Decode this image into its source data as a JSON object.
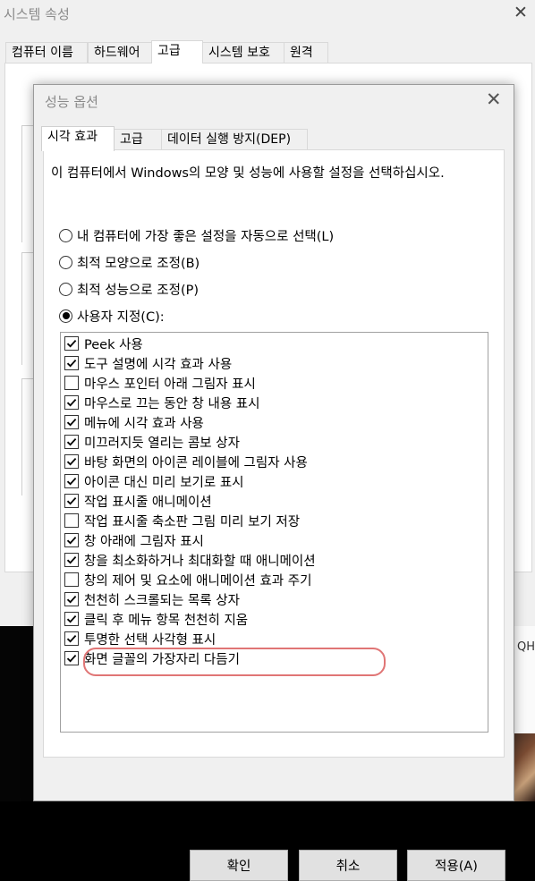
{
  "background_window": {
    "title": "시스템 속성",
    "close_glyph": "✕",
    "tabs": [
      "컴퓨터 이름",
      "하드웨어",
      "고급",
      "시스템 보호",
      "원격"
    ],
    "active_tab": "고급",
    "bottom_right_text": "QH"
  },
  "dialog": {
    "title": "성능 옵션",
    "close_glyph": "✕",
    "tabs": [
      "시각 효과",
      "고급",
      "데이터 실행 방지(DEP)"
    ],
    "active_tab": "시각 효과",
    "description": "이 컴퓨터에서 Windows의 모양 및 성능에 사용할 설정을 선택하십시오.",
    "radio_options": [
      {
        "label": "내 컴퓨터에 가장 좋은 설정을 자동으로 선택(L)",
        "selected": false
      },
      {
        "label": "최적 모양으로 조정(B)",
        "selected": false
      },
      {
        "label": "최적 성능으로 조정(P)",
        "selected": false
      },
      {
        "label": "사용자 지정(C):",
        "selected": true
      }
    ],
    "effects": [
      {
        "label": "Peek 사용",
        "checked": true
      },
      {
        "label": "도구 설명에 시각 효과 사용",
        "checked": true
      },
      {
        "label": "마우스 포인터 아래 그림자 표시",
        "checked": false
      },
      {
        "label": "마우스로 끄는 동안 창 내용 표시",
        "checked": true
      },
      {
        "label": "메뉴에 시각 효과 사용",
        "checked": true
      },
      {
        "label": "미끄러지듯 열리는 콤보 상자",
        "checked": true
      },
      {
        "label": "바탕 화면의 아이콘 레이블에 그림자 사용",
        "checked": true
      },
      {
        "label": "아이콘 대신 미리 보기로 표시",
        "checked": true
      },
      {
        "label": "작업 표시줄 애니메이션",
        "checked": true
      },
      {
        "label": "작업 표시줄 축소판 그림 미리 보기 저장",
        "checked": false
      },
      {
        "label": "창 아래에 그림자 표시",
        "checked": true
      },
      {
        "label": "창을 최소화하거나 최대화할 때 애니메이션",
        "checked": true
      },
      {
        "label": "창의 제어 및 요소에 애니메이션 효과 주기",
        "checked": false,
        "highlighted": true
      },
      {
        "label": "천천히 스크롤되는 목록 상자",
        "checked": true
      },
      {
        "label": "클릭 후 메뉴 항목 천천히 지움",
        "checked": true
      },
      {
        "label": "투명한 선택 사각형 표시",
        "checked": true
      },
      {
        "label": "화면 글꼴의 가장자리 다듬기",
        "checked": true
      }
    ],
    "buttons": {
      "ok": "확인",
      "cancel": "취소",
      "apply": "적용(A)"
    },
    "highlight_color": "#e07575"
  }
}
